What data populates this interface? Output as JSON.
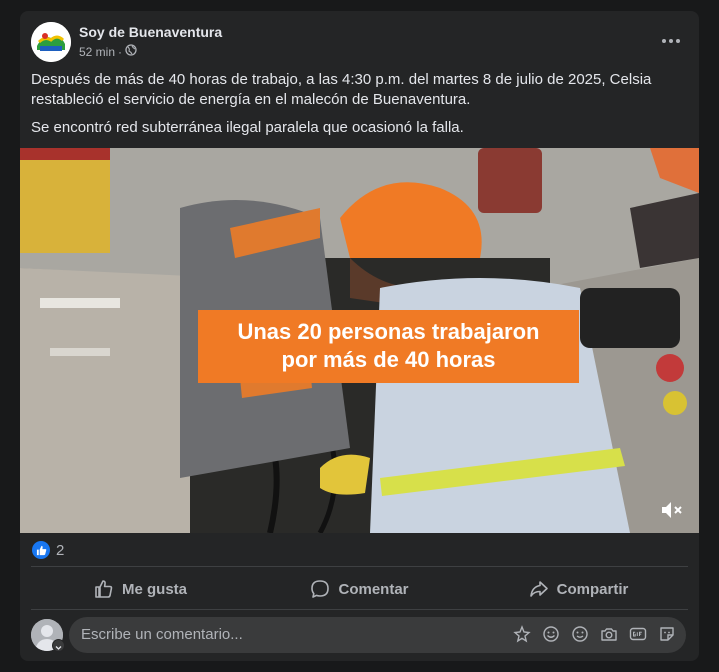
{
  "post": {
    "page_name": "Soy de Buenaventura",
    "time": "52 min",
    "separator": "·",
    "privacy_icon": "globe-icon",
    "paragraphs": [
      "Después de más de 40 horas de trabajo, a las 4:30 p.m. del martes 8 de julio de 2025, Celsia restableció el servicio de energía en el malecón de Buenaventura.",
      "Se encontró red subterránea ilegal paralela que ocasionó la falla."
    ],
    "video_caption_line1": "Unas 20 personas trabajaron",
    "video_caption_line2": "por más de 40 horas"
  },
  "reactions": {
    "icon": "like-icon",
    "count": "2"
  },
  "actions": {
    "like": "Me gusta",
    "comment": "Comentar",
    "share": "Compartir"
  },
  "comment_input": {
    "placeholder": "Escribe un comentario..."
  },
  "colors": {
    "card": "#242526",
    "accent": "#1877f2",
    "caption_bg": "#f07a25"
  }
}
